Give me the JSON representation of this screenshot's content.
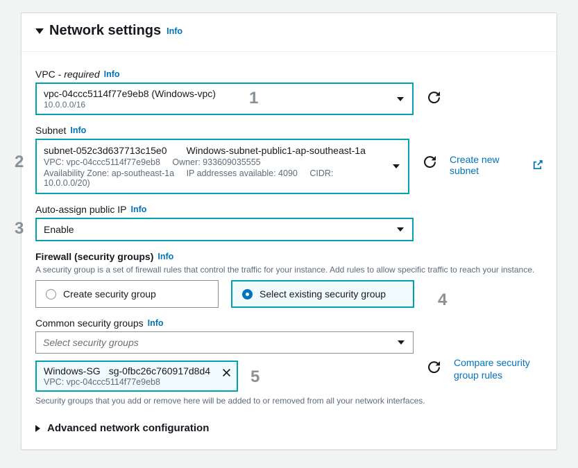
{
  "header": {
    "title": "Network settings",
    "info": "Info"
  },
  "vpc": {
    "label": "VPC - ",
    "required": "required",
    "info": "Info",
    "value_main": "vpc-04ccc5114f77e9eb8 (Windows-vpc)",
    "value_sub": "10.0.0.0/16",
    "annot": "1"
  },
  "subnet": {
    "label": "Subnet",
    "info": "Info",
    "id": "subnet-052c3d637713c15e0",
    "name": "Windows-subnet-public1-ap-southeast-1a",
    "sub_vpc": "VPC: vpc-04ccc5114f77e9eb8",
    "sub_owner": "Owner: 933609035555",
    "sub_az": "Availability Zone: ap-southeast-1a",
    "sub_ips": "IP addresses available: 4090",
    "sub_cidr": "CIDR: 10.0.0.0/20)",
    "create_link": "Create new subnet",
    "annot": "2"
  },
  "autoip": {
    "label": "Auto-assign public IP",
    "info": "Info",
    "value": "Enable",
    "annot": "3"
  },
  "firewall": {
    "label": "Firewall (security groups)",
    "info": "Info",
    "desc": "A security group is a set of firewall rules that control the traffic for your instance. Add rules to allow specific traffic to reach your instance.",
    "opt_create": "Create security group",
    "opt_select": "Select existing security group",
    "annot": "4"
  },
  "common_sg": {
    "label": "Common security groups",
    "info": "Info",
    "placeholder": "Select security groups",
    "token_name": "Windows-SG",
    "token_id": "sg-0fbc26c760917d8d4",
    "token_sub": "VPC: vpc-04ccc5114f77e9eb8",
    "helper": "Security groups that you add or remove here will be added to or removed from all your network interfaces.",
    "compare": "Compare security group rules",
    "annot": "5"
  },
  "advanced": {
    "label": "Advanced network configuration"
  }
}
